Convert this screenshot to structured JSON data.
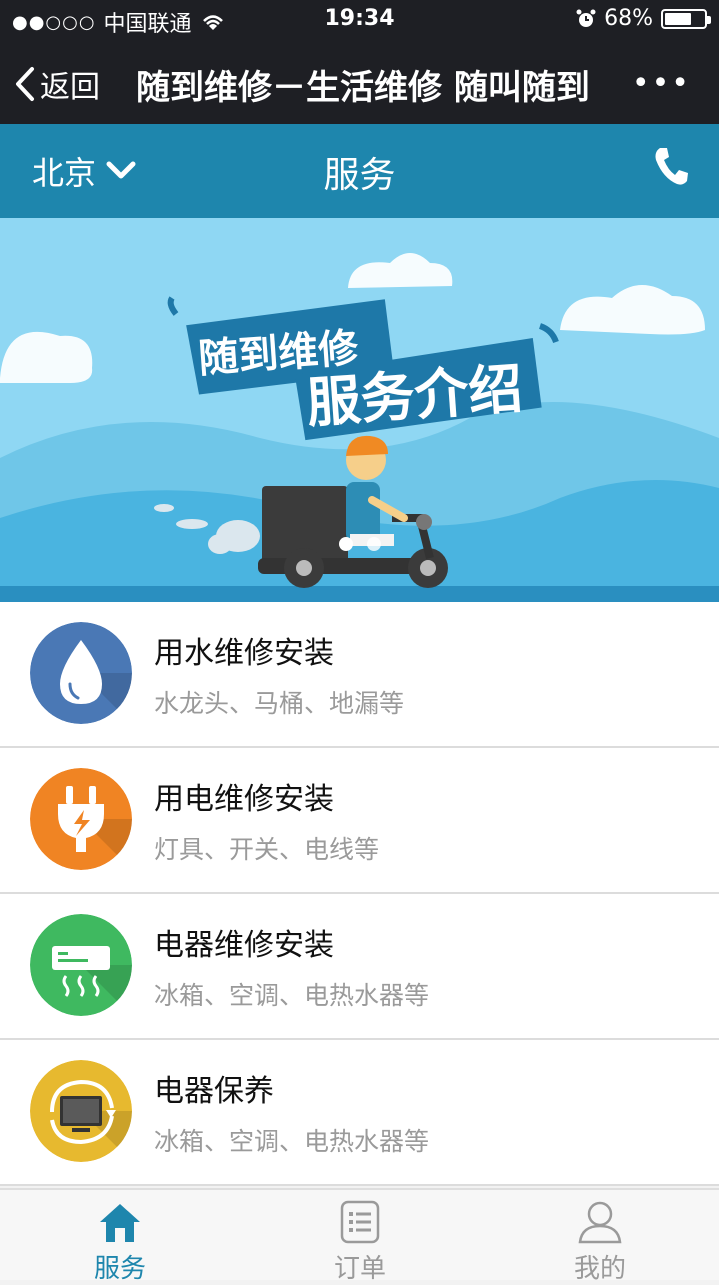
{
  "status_bar": {
    "carrier": "中国联通",
    "signal_dots": "●●○○○",
    "time": "19:34",
    "battery": "68%",
    "battery_level": 0.68
  },
  "title_bar": {
    "back_label": "返回",
    "title": "随到维修－生活维修 随叫随到",
    "more_label": "•••"
  },
  "app_header": {
    "city": "北京",
    "title": "服务"
  },
  "banner": {
    "line1": "随到维修",
    "line2": "服务介绍"
  },
  "services": [
    {
      "title": "用水维修安装",
      "subtitle": "水龙头、马桶、地漏等",
      "color": "#4a78b5",
      "icon": "water-drop-icon"
    },
    {
      "title": "用电维修安装",
      "subtitle": "灯具、开关、电线等",
      "color": "#f08423",
      "icon": "plug-icon"
    },
    {
      "title": "电器维修安装",
      "subtitle": "冰箱、空调、电热水器等",
      "color": "#3fb960",
      "icon": "air-conditioner-icon"
    },
    {
      "title": "电器保养",
      "subtitle": "冰箱、空调、电热水器等",
      "color": "#e7b92f",
      "icon": "tv-maintenance-icon"
    }
  ],
  "tabs": [
    {
      "label": "服务",
      "active": true
    },
    {
      "label": "订单",
      "active": false
    },
    {
      "label": "我的",
      "active": false
    }
  ],
  "colors": {
    "accent": "#1e86ad",
    "dark_bar": "#1e1f24",
    "tab_active": "#1e86ad",
    "tab_inactive": "#9a9a9a"
  }
}
